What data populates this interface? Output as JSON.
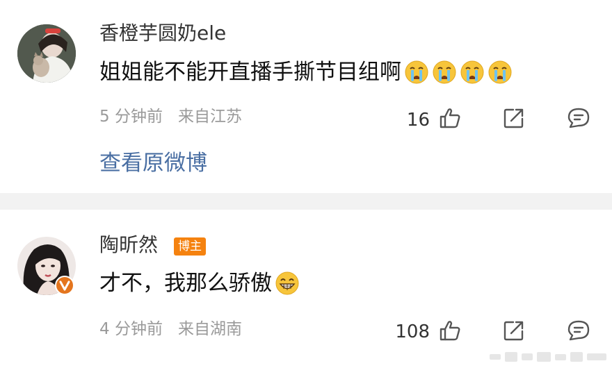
{
  "comments": [
    {
      "username": "香橙芋圆奶ele",
      "content": "姐姐能不能开直播手撕节目组啊",
      "emoji_count": 4,
      "emoji": "crying-face-icon",
      "time": "5 分钟前",
      "location": "来自江苏",
      "likes": "16",
      "view_link": "查看原微博"
    },
    {
      "username": "陶昕然",
      "badge": "博主",
      "content": "才不，我那么骄傲",
      "emoji": "grinning-face-icon",
      "time": "4 分钟前",
      "location": "来自湖南",
      "likes": "108"
    }
  ],
  "colors": {
    "link": "#4a6fa3",
    "badge": "#f5820f",
    "meta": "#9a9a9a",
    "verified": "#e4751e"
  }
}
